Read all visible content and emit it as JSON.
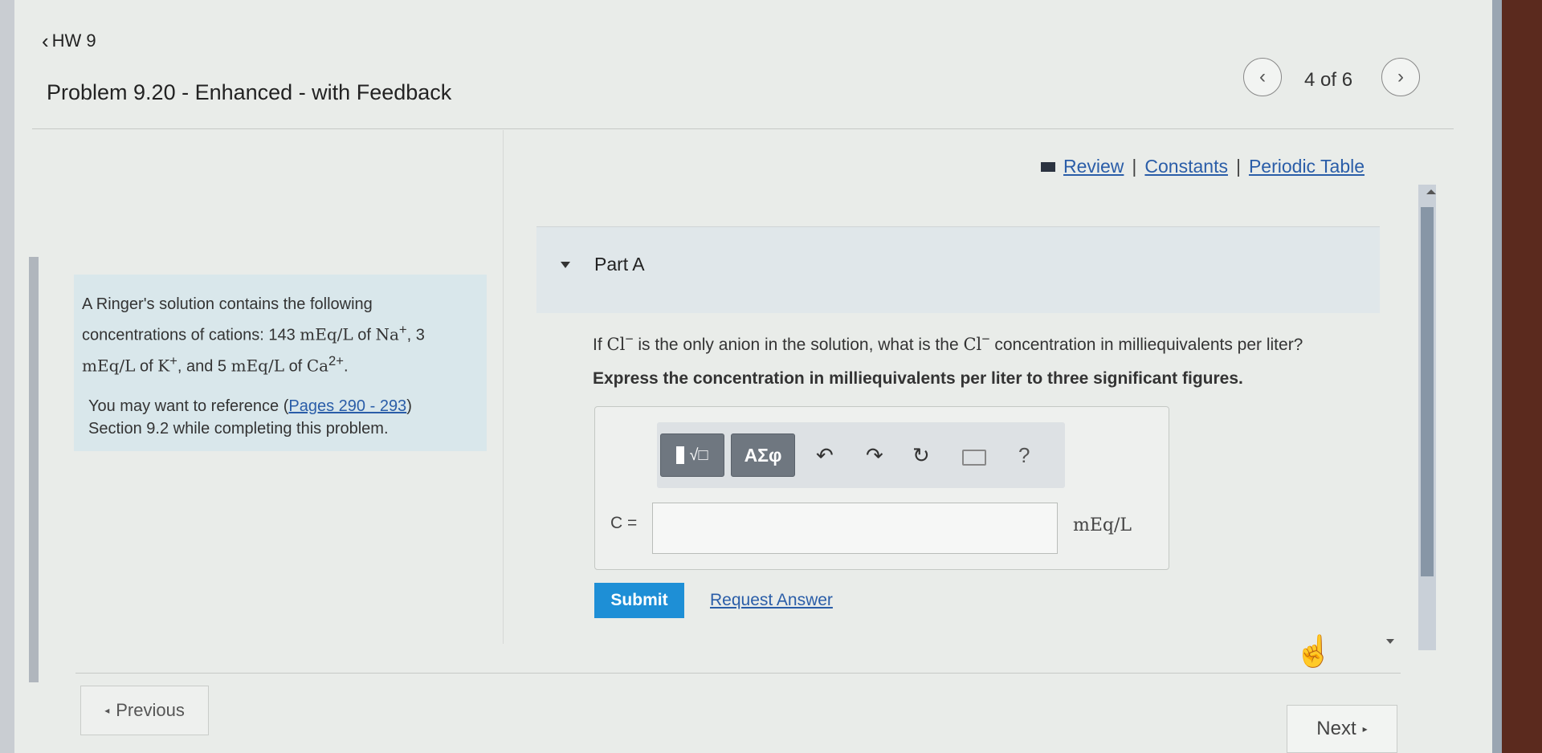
{
  "header": {
    "back_label": "HW 9",
    "problem_title": "Problem 9.20 - Enhanced - with Feedback",
    "page_count": "4 of 6"
  },
  "resources": {
    "review": "Review",
    "constants": "Constants",
    "periodic_table": "Periodic Table",
    "separator": "|"
  },
  "context": {
    "line1": "A Ringer's solution contains the following",
    "line2_prefix": "concentrations of cations: 143 ",
    "unit": "mEq/L",
    "of": "of",
    "na": "Na",
    "na_sup": "+",
    "line2_suffix": ", 3",
    "line3_mid": ", and 5 ",
    "k": "K",
    "k_sup": "+",
    "ca": "Ca",
    "ca_sup": "2+",
    "period": ".",
    "ref_prefix": "You may want to reference (",
    "ref_link": "Pages 290 - 293",
    "ref_suffix": ")",
    "ref_line2": "Section 9.2 while completing this problem."
  },
  "part": {
    "label": "Part A",
    "question_prefix": "If ",
    "cl": "Cl",
    "cl_sup": "−",
    "question_mid": " is the only anion in the solution, what is the ",
    "question_suffix": " concentration in milliequivalents per liter?",
    "instruction": "Express the concentration in milliequivalents per liter to three significant figures."
  },
  "toolbar": {
    "templates_label": "√□",
    "symbols_label": "ΑΣφ",
    "undo_icon": "undo-icon",
    "redo_icon": "redo-icon",
    "reset_icon": "reset-icon",
    "keyboard_icon": "keyboard-icon",
    "help_label": "?"
  },
  "answer": {
    "variable_label": "C =",
    "value": "",
    "unit": "mEq/L"
  },
  "actions": {
    "submit": "Submit",
    "request_answer": "Request Answer",
    "previous": "Previous",
    "next": "Next"
  }
}
